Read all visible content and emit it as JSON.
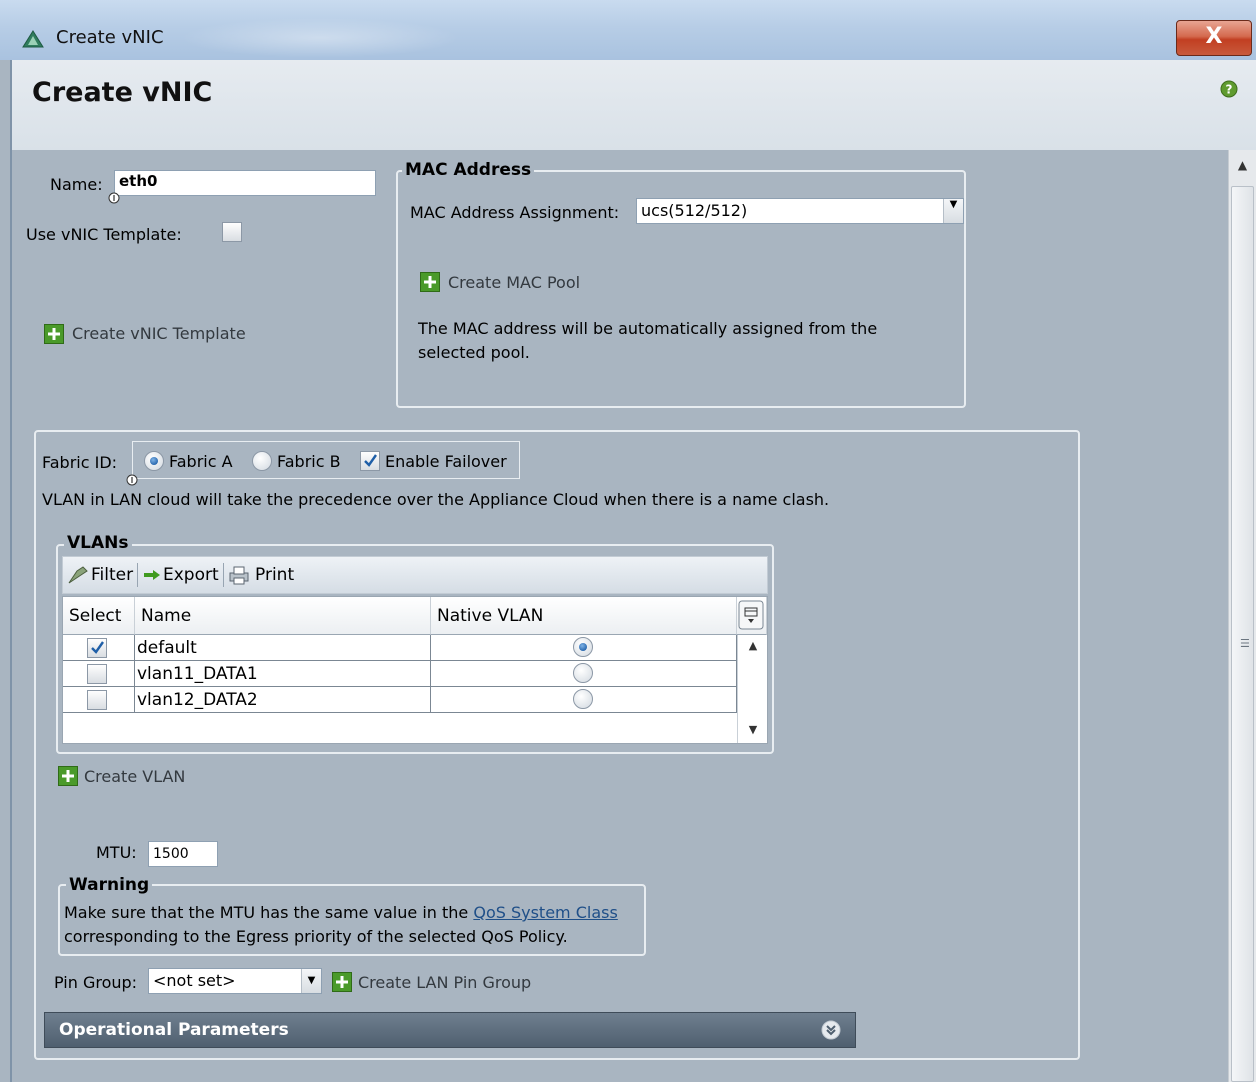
{
  "window": {
    "title": "Create vNIC",
    "close_label": "X"
  },
  "header": {
    "title": "Create vNIC"
  },
  "form": {
    "name_label": "Name:",
    "name_value": "eth0",
    "use_template_label": "Use vNIC Template:",
    "use_template_checked": false,
    "create_template_link": "Create vNIC Template"
  },
  "mac": {
    "legend": "MAC Address",
    "assignment_label": "MAC Address Assignment:",
    "assignment_value": "ucs(512/512)",
    "create_pool_link": "Create MAC Pool",
    "info_line1": "The MAC address will be automatically assigned from the",
    "info_line2": "selected pool."
  },
  "fabric": {
    "label": "Fabric ID:",
    "option_a": "Fabric A",
    "option_b": "Fabric B",
    "selected": "Fabric A",
    "failover_label": "Enable Failover",
    "failover_checked": true,
    "note": "VLAN in LAN cloud will take the precedence over the Appliance Cloud when there is a name clash."
  },
  "vlans": {
    "legend": "VLANs",
    "toolbar": {
      "filter": "Filter",
      "export": "Export",
      "print": "Print"
    },
    "columns": [
      "Select",
      "Name",
      "Native VLAN"
    ],
    "rows": [
      {
        "selected": true,
        "name": "default",
        "native": true
      },
      {
        "selected": false,
        "name": "vlan11_DATA1",
        "native": false
      },
      {
        "selected": false,
        "name": "vlan12_DATA2",
        "native": false
      }
    ],
    "create_link": "Create VLAN"
  },
  "mtu": {
    "label": "MTU:",
    "value": "1500"
  },
  "warning": {
    "legend": "Warning",
    "line1_prefix": "Make sure that the MTU has the same value in the ",
    "line1_link": "QoS System Class",
    "line2": "corresponding to the Egress priority of the selected QoS Policy."
  },
  "pin_group": {
    "label": "Pin Group:",
    "value": "<not set>",
    "create_link": "Create LAN Pin Group"
  },
  "operational": {
    "label": "Operational Parameters"
  },
  "icons": {
    "app": "triangle-app-icon",
    "help": "help-icon",
    "plus": "plus-icon",
    "filter": "filter-icon",
    "export": "export-arrow-icon",
    "print": "printer-icon",
    "column_chooser": "column-chooser-icon",
    "expand": "double-chevron-down-icon"
  },
  "colors": {
    "accent_green": "#4a9a2a",
    "panel_bg": "#a9b5c1",
    "radio_selected": "#1f5fa8"
  }
}
